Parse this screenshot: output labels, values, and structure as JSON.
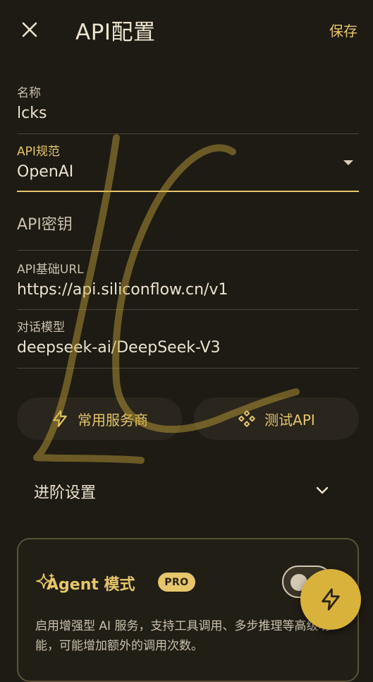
{
  "header": {
    "title": "API配置",
    "save_label": "保存"
  },
  "fields": {
    "name": {
      "label": "名称",
      "value": "lcks"
    },
    "spec": {
      "label": "API规范",
      "value": "OpenAI"
    },
    "key": {
      "placeholder": "API密钥"
    },
    "base_url": {
      "label": "API基础URL",
      "value": "https://api.siliconflow.cn/v1"
    },
    "model": {
      "label": "对话模型",
      "value": "deepseek-ai/DeepSeek-V3"
    }
  },
  "actions": {
    "providers_label": "常用服务商",
    "test_label": "测试API"
  },
  "advanced": {
    "label": "进阶设置"
  },
  "agent": {
    "title": "Agent 模式",
    "badge": "PRO",
    "description": "启用增强型 AI 服务，支持工具调用、多步推理等高级功能，可能增加额外的调用次数。"
  },
  "colors": {
    "accent": "#e6c66b",
    "background": "#1e1b14",
    "fab": "#d8b23a"
  },
  "icons": [
    "close-icon",
    "dropdown-arrow-icon",
    "lightning-icon",
    "diamond-dots-icon",
    "chevron-down-icon",
    "sparkles-icon"
  ]
}
